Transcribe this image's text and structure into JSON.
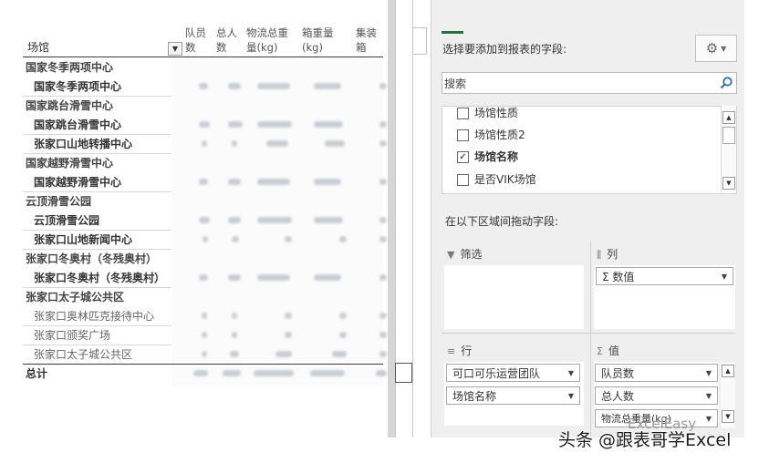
{
  "pivot": {
    "headers": {
      "row_field": "场馆",
      "col1": "队员",
      "col1b": "数",
      "col2": "总人",
      "col2b": "数",
      "col3": "物流总重",
      "col3b": "量(kg)",
      "col4": "箱重量",
      "col4b": "(kg)",
      "col5": "集装",
      "col5b": "箱"
    },
    "rows": [
      {
        "label": "国家冬季两项中心"
      },
      {
        "label": "国家冬季两项中心"
      },
      {
        "label": "国家跳台滑雪中心"
      },
      {
        "label": "国家跳台滑雪中心"
      },
      {
        "label": "张家口山地转播中心"
      },
      {
        "label": "国家越野滑雪中心"
      },
      {
        "label": "国家越野滑雪中心"
      },
      {
        "label": "云顶滑雪公园"
      },
      {
        "label": "云顶滑雪公园"
      },
      {
        "label": "张家口山地新闻中心"
      },
      {
        "label": "张家口冬奥村（冬残奥村）"
      },
      {
        "label": "张家口冬奥村（冬残奥村）"
      },
      {
        "label": "张家口太子城公共区"
      },
      {
        "label": "张家口奥林匹克接待中心"
      },
      {
        "label": "张家口颁奖广场"
      },
      {
        "label": "张家口太子城公共区"
      }
    ],
    "total_label": "总计"
  },
  "field_list": {
    "title": "选择要添加到报表的字段:",
    "search_placeholder": "搜索",
    "fields": [
      {
        "label": "场馆性质",
        "checked": false
      },
      {
        "label": "场馆性质2",
        "checked": false
      },
      {
        "label": "场馆名称",
        "checked": true
      },
      {
        "label": "是否VIK场馆",
        "checked": false
      }
    ],
    "drag_hint": "在以下区域间拖动字段:",
    "areas": {
      "filter": "筛选",
      "columns": "列",
      "rows": "行",
      "values": "值"
    },
    "columns_items": [
      "Σ 数值"
    ],
    "rows_items": [
      "可口可乐运营团队",
      "场馆名称"
    ],
    "values_items": [
      "队员数",
      "总人数",
      "物流总重量(kg)"
    ]
  },
  "watermark": {
    "main": "头条 @跟表哥学Excel",
    "faint": "ExcelEasy"
  },
  "colors": {
    "accent": "#217346"
  }
}
